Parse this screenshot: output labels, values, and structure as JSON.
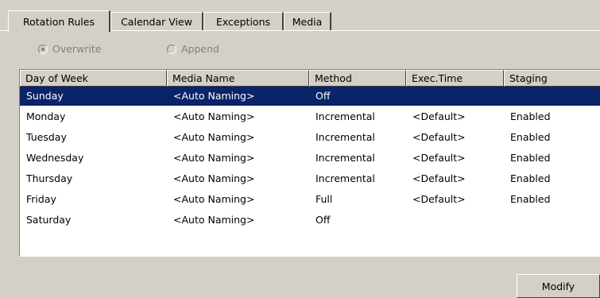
{
  "tabs": [
    {
      "label": "Rotation Rules",
      "active": true
    },
    {
      "label": "Calendar View",
      "active": false
    },
    {
      "label": "Exceptions",
      "active": false
    },
    {
      "label": "Media",
      "active": false
    }
  ],
  "mode": {
    "overwrite_label": "Overwrite",
    "append_label": "Append",
    "selected": "Overwrite",
    "enabled": false
  },
  "table": {
    "columns": [
      "Day of Week",
      "Media Name",
      "Method",
      "Exec.Time",
      "Staging"
    ],
    "rows": [
      {
        "day": "Sunday",
        "media": "<Auto Naming>",
        "method": "Off",
        "exec": "",
        "staging": ""
      },
      {
        "day": "Monday",
        "media": "<Auto Naming>",
        "method": "Incremental",
        "exec": "<Default>",
        "staging": "Enabled"
      },
      {
        "day": "Tuesday",
        "media": "<Auto Naming>",
        "method": "Incremental",
        "exec": "<Default>",
        "staging": "Enabled"
      },
      {
        "day": "Wednesday",
        "media": "<Auto Naming>",
        "method": "Incremental",
        "exec": "<Default>",
        "staging": "Enabled"
      },
      {
        "day": "Thursday",
        "media": "<Auto Naming>",
        "method": "Incremental",
        "exec": "<Default>",
        "staging": "Enabled"
      },
      {
        "day": "Friday",
        "media": "<Auto Naming>",
        "method": "Full",
        "exec": "<Default>",
        "staging": "Enabled"
      },
      {
        "day": "Saturday",
        "media": "<Auto Naming>",
        "method": "Off",
        "exec": "",
        "staging": ""
      }
    ],
    "selected_row": "Sunday"
  },
  "buttons": {
    "modify_label": "Modify"
  },
  "colors": {
    "face": "#d4d0c8",
    "selection": "#0a246a",
    "disabled_text": "#808080"
  }
}
